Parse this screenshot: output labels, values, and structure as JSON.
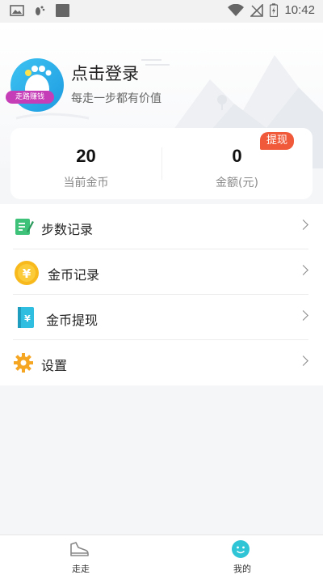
{
  "status_bar": {
    "time": "10:42"
  },
  "header": {
    "avatar_badge": "走路赚钱",
    "login_title": "点击登录",
    "login_subtitle": "每走一步都有价值"
  },
  "stats": {
    "coins_value": "20",
    "coins_label": "当前金币",
    "amount_value": "0",
    "amount_label": "金额(元)",
    "withdraw_badge": "提现"
  },
  "menu": {
    "items": [
      {
        "label": "步数记录",
        "icon": "step-record-icon"
      },
      {
        "label": "金币记录",
        "icon": "yen-coin-icon"
      },
      {
        "label": "金币提现",
        "icon": "withdraw-book-icon"
      },
      {
        "label": "设置",
        "icon": "gear-icon"
      }
    ]
  },
  "bottom_nav": {
    "tabs": [
      {
        "label": "走走",
        "icon": "shoe-icon"
      },
      {
        "label": "我的",
        "icon": "smiley-icon",
        "active": true
      }
    ]
  },
  "colors": {
    "accent": "#2fc4d6",
    "badge": "#f05a3a",
    "avatar": "#1e9be0"
  }
}
